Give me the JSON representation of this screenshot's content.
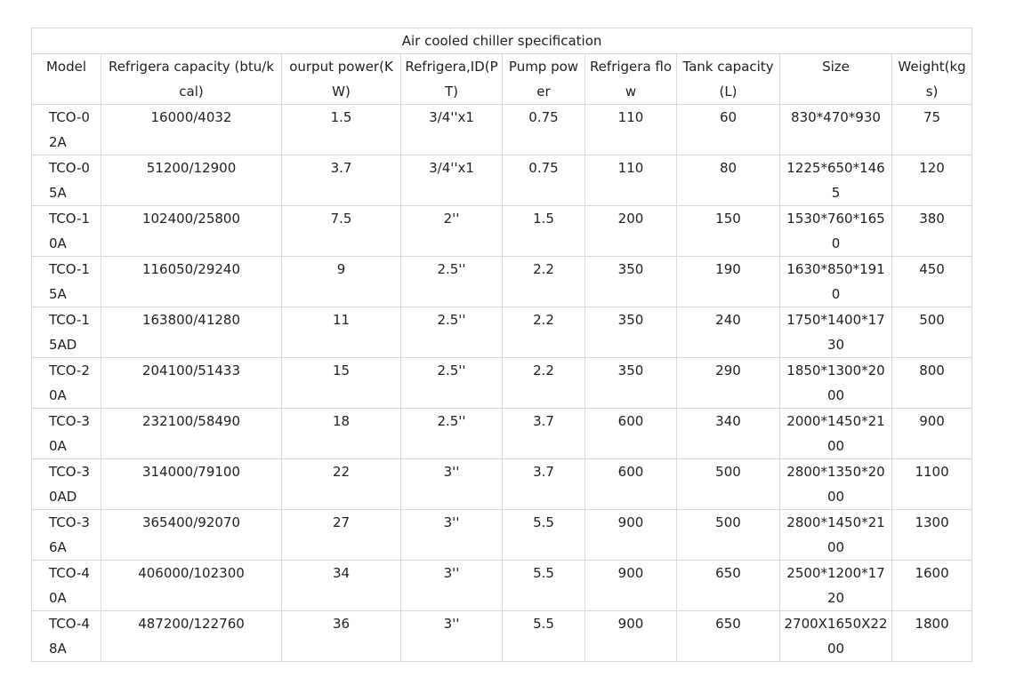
{
  "table": {
    "title": "Air cooled chiller specification",
    "columns": [
      "Model",
      "Refrigera capacity (btu/kcal)",
      "ourput power(KW)",
      "Refrigera,ID(PT)",
      "Pump power",
      "Refrigera flow",
      "Tank capacity(L)",
      "Size",
      "Weight(kgs)"
    ],
    "rows": [
      [
        "TCO-02A",
        "16000/4032",
        "1.5",
        "3/4''x1",
        "0.75",
        "110",
        "60",
        "830*470*930",
        "75"
      ],
      [
        "TCO-05A",
        "51200/12900",
        "3.7",
        "3/4''x1",
        "0.75",
        "110",
        "80",
        "1225*650*1465",
        "120"
      ],
      [
        "TCO-10A",
        "102400/25800",
        "7.5",
        "2''",
        "1.5",
        "200",
        "150",
        "1530*760*1650",
        "380"
      ],
      [
        "TCO-15A",
        "116050/29240",
        "9",
        "2.5''",
        "2.2",
        "350",
        "190",
        "1630*850*1910",
        "450"
      ],
      [
        "TCO-15AD",
        "163800/41280",
        "11",
        "2.5''",
        "2.2",
        "350",
        "240",
        "1750*1400*1730",
        "500"
      ],
      [
        "TCO-20A",
        "204100/51433",
        "15",
        "2.5''",
        "2.2",
        "350",
        "290",
        "1850*1300*2000",
        "800"
      ],
      [
        "TCO-30A",
        "232100/58490",
        "18",
        "2.5''",
        "3.7",
        "600",
        "340",
        "2000*1450*2100",
        "900"
      ],
      [
        "TCO-30AD",
        "314000/79100",
        "22",
        "3''",
        "3.7",
        "600",
        "500",
        "2800*1350*2000",
        "1100"
      ],
      [
        "TCO-36A",
        "365400/92070",
        "27",
        "3''",
        "5.5",
        "900",
        "500",
        "2800*1450*2100",
        "1300"
      ],
      [
        "TCO-40A",
        "406000/102300",
        "34",
        "3''",
        "5.5",
        "900",
        "650",
        "2500*1200*1720",
        "1600"
      ],
      [
        "TCO-48A",
        "487200/122760",
        "36",
        "3''",
        "5.5",
        "900",
        "650",
        "2700X1650X2200",
        "1800"
      ]
    ]
  }
}
